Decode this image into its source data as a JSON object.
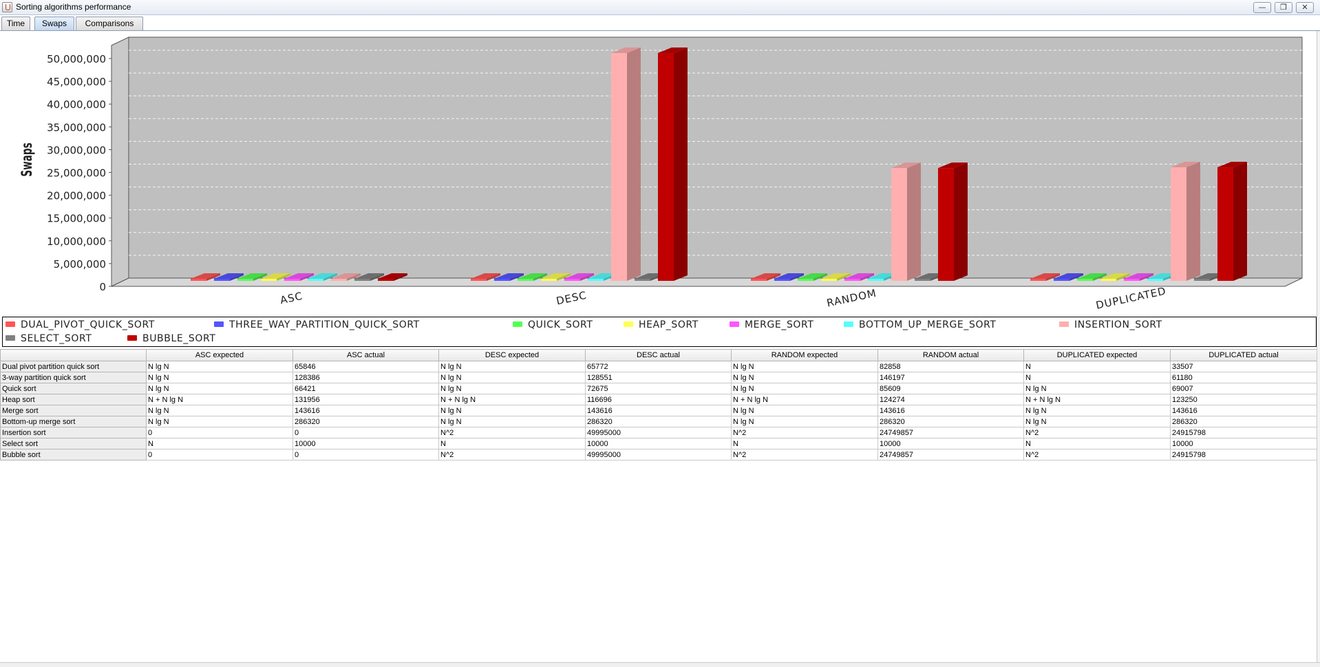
{
  "window": {
    "title": "Sorting algorithms performance"
  },
  "tabs": [
    {
      "label": "Time",
      "active": false
    },
    {
      "label": "Swaps",
      "active": true
    },
    {
      "label": "Comparisons",
      "active": false
    }
  ],
  "colors": {
    "plot_bg": "#bfbfbf",
    "series": [
      "#ff5555",
      "#5555ff",
      "#55ff55",
      "#ffff55",
      "#ff55ff",
      "#55ffff",
      "#ffafaf",
      "#808080",
      "#c00000"
    ]
  },
  "chart_data": {
    "type": "bar",
    "ylabel": "Swaps",
    "ylim": [
      0,
      52000000
    ],
    "yticks": [
      0,
      5000000,
      10000000,
      15000000,
      20000000,
      25000000,
      30000000,
      35000000,
      40000000,
      45000000,
      50000000
    ],
    "ytick_labels": [
      "0",
      "5,000,000",
      "10,000,000",
      "15,000,000",
      "20,000,000",
      "25,000,000",
      "30,000,000",
      "35,000,000",
      "40,000,000",
      "45,000,000",
      "50,000,000"
    ],
    "grid": true,
    "legend_position": "bottom",
    "categories": [
      "ASC",
      "DESC",
      "RANDOM",
      "DUPLICATED"
    ],
    "series": [
      {
        "name": "DUAL_PIVOT_QUICK_SORT",
        "values": [
          65846,
          65772,
          82858,
          33507
        ]
      },
      {
        "name": "THREE_WAY_PARTITION_QUICK_SORT",
        "values": [
          128386,
          128551,
          146197,
          61180
        ]
      },
      {
        "name": "QUICK_SORT",
        "values": [
          66421,
          72675,
          85609,
          69007
        ]
      },
      {
        "name": "HEAP_SORT",
        "values": [
          131956,
          116696,
          124274,
          123250
        ]
      },
      {
        "name": "MERGE_SORT",
        "values": [
          143616,
          143616,
          143616,
          143616
        ]
      },
      {
        "name": "BOTTOM_UP_MERGE_SORT",
        "values": [
          286320,
          286320,
          286320,
          286320
        ]
      },
      {
        "name": "INSERTION_SORT",
        "values": [
          0,
          49995000,
          24749857,
          24915798
        ]
      },
      {
        "name": "SELECT_SORT",
        "values": [
          10000,
          10000,
          10000,
          10000
        ]
      },
      {
        "name": "BUBBLE_SORT",
        "values": [
          0,
          49995000,
          24749857,
          24915798
        ]
      }
    ]
  },
  "table": {
    "columns": [
      "",
      "ASC expected",
      "ASC actual",
      "DESC expected",
      "DESC actual",
      "RANDOM expected",
      "RANDOM actual",
      "DUPLICATED expected",
      "DUPLICATED actual"
    ],
    "rows": [
      [
        "Dual pivot partition quick sort",
        "N lg N",
        "65846",
        "N lg N",
        "65772",
        "N lg N",
        "82858",
        "N",
        "33507"
      ],
      [
        "3-way partition quick sort",
        "N lg N",
        "128386",
        "N lg N",
        "128551",
        "N lg N",
        "146197",
        "N",
        "61180"
      ],
      [
        "Quick sort",
        "N lg N",
        "66421",
        "N lg N",
        "72675",
        "N lg N",
        "85609",
        "N lg N",
        "69007"
      ],
      [
        "Heap sort",
        "N + N lg N",
        "131956",
        "N + N lg N",
        "116696",
        "N + N lg N",
        "124274",
        "N + N lg N",
        "123250"
      ],
      [
        "Merge sort",
        "N lg N",
        "143616",
        "N lg N",
        "143616",
        "N lg N",
        "143616",
        "N lg N",
        "143616"
      ],
      [
        "Bottom-up merge sort",
        "N lg N",
        "286320",
        "N lg N",
        "286320",
        "N lg N",
        "286320",
        "N lg N",
        "286320"
      ],
      [
        "Insertion sort",
        "0",
        "0",
        "N^2",
        "49995000",
        "N^2",
        "24749857",
        "N^2",
        "24915798"
      ],
      [
        "Select sort",
        "N",
        "10000",
        "N",
        "10000",
        "N",
        "10000",
        "N",
        "10000"
      ],
      [
        "Bubble sort",
        "0",
        "0",
        "N^2",
        "49995000",
        "N^2",
        "24749857",
        "N^2",
        "24915798"
      ]
    ]
  }
}
